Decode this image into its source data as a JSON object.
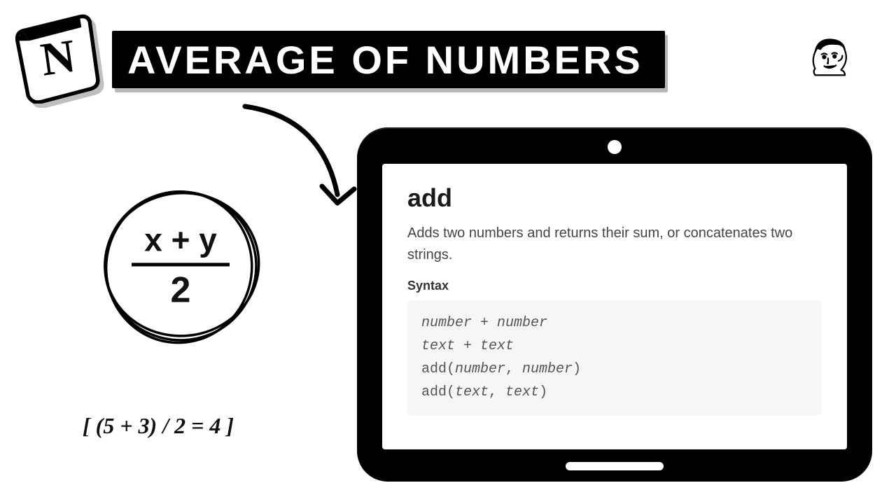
{
  "title": "AVERAGE OF NUMBERS",
  "formula": {
    "numerator": "x + y",
    "denominator": "2"
  },
  "example": "[ (5 + 3) / 2 = 4 ]",
  "doc": {
    "heading": "add",
    "description": "Adds two numbers and returns their sum, or concatenates two strings.",
    "syntax_label": "Syntax",
    "code": {
      "line1_a": "number",
      "line1_op": " + ",
      "line1_b": "number",
      "line2_a": "text",
      "line2_op": " + ",
      "line2_b": "text",
      "line3_fn": "add(",
      "line3_a": "number",
      "line3_sep": ", ",
      "line3_b": "number",
      "line3_end": ")",
      "line4_fn": "add(",
      "line4_a": "text",
      "line4_sep": ", ",
      "line4_b": "text",
      "line4_end": ")"
    }
  }
}
